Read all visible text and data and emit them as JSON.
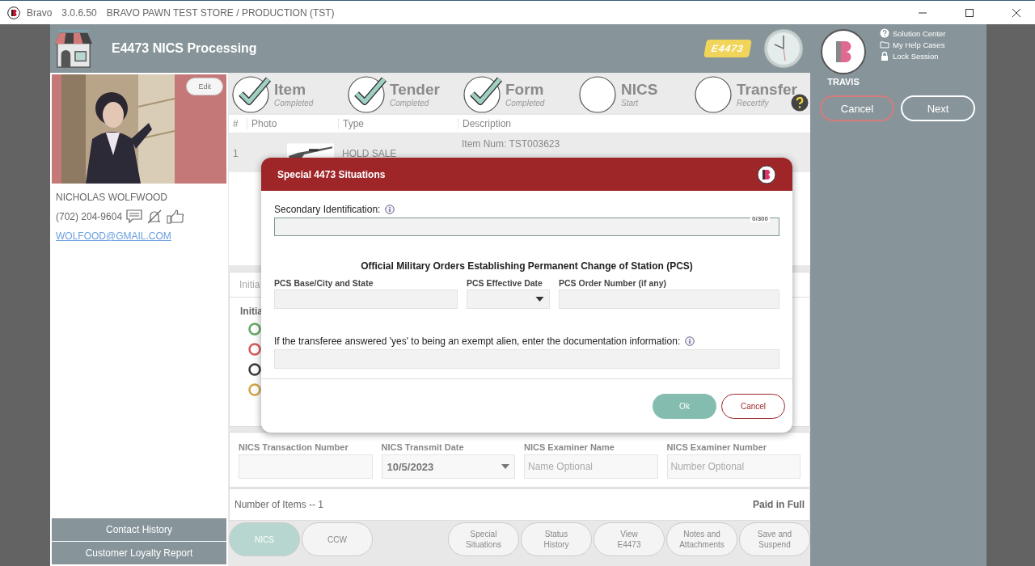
{
  "title_bar": {
    "app_name": "Bravo",
    "version": "3.0.6.50",
    "store": "BRAVO PAWN TEST STORE / PRODUCTION (TST)"
  },
  "header": {
    "title": "E4473 NICS Processing",
    "badge": "E4473"
  },
  "user": {
    "name": "TRAVIS",
    "links": [
      {
        "label": "Solution Center",
        "kind": "help"
      },
      {
        "label": "My Help Cases",
        "kind": "folder"
      },
      {
        "label": "Lock Session",
        "kind": "lock"
      }
    ],
    "buttons": [
      {
        "label": "Cancel",
        "kind": "danger"
      },
      {
        "label": "Next",
        "kind": "primary"
      }
    ]
  },
  "customer": {
    "edit": "Edit",
    "name": "NICHOLAS WOLFWOOD",
    "phone": "(702) 204-9604",
    "email": "WOLFOOD@GMAIL.COM",
    "buttons": [
      "Contact History",
      "Customer Loyalty Report"
    ]
  },
  "steps": [
    {
      "label": "Item",
      "status": "Completed",
      "completed": true
    },
    {
      "label": "Tender",
      "status": "Completed",
      "completed": true
    },
    {
      "label": "Form",
      "status": "Completed",
      "completed": true
    },
    {
      "label": "NICS",
      "status": "Start",
      "completed": false
    },
    {
      "label": "Transfer",
      "status": "Recertify",
      "completed": false
    }
  ],
  "table": {
    "columns": [
      "#",
      "Photo",
      "Type",
      "Description"
    ],
    "rows": [
      {
        "number": "1",
        "type": "HOLD SALE",
        "description": "Item Num: TST003623",
        "selected": true
      }
    ]
  },
  "initial_panel": {
    "tab": "Initia",
    "heading": "Initia",
    "options": [
      {
        "color": "#62a862"
      },
      {
        "color": "#d75a5a"
      },
      {
        "color": "#3a3a3a"
      },
      {
        "color": "#d1a646"
      }
    ]
  },
  "nics_fields": [
    {
      "label": "NICS Transaction Number",
      "kind": "text"
    },
    {
      "label": "NICS Transmit Date",
      "kind": "dropdown",
      "value": "10/5/2023"
    },
    {
      "label": "NICS Examiner Name",
      "kind": "text",
      "placeholder": "Name Optional"
    },
    {
      "label": "NICS Examiner Number",
      "kind": "text",
      "placeholder": "Number Optional"
    }
  ],
  "summary": {
    "count": "Number of Items -- 1",
    "status": "Paid in Full"
  },
  "mode_buttons": [
    {
      "label": "NICS",
      "selected": true
    },
    {
      "label": "CCW",
      "selected": false
    }
  ],
  "action_buttons": [
    "Special\nSituations",
    "Status\nHistory",
    "View\nE4473",
    "Notes and\nAttachments",
    "Save and\nSuspend"
  ],
  "modal": {
    "title": "Special 4473 Situations",
    "secondary_id": {
      "label": "Secondary Identification:",
      "counter": "0/300"
    },
    "section_title": "Official Military Orders Establishing Permanent Change of Station (PCS)",
    "pcs_fields": [
      {
        "label": "PCS Base/City and State",
        "kind": "text"
      },
      {
        "label": "PCS Effective Date",
        "kind": "dropdown"
      },
      {
        "label": "PCS Order Number (if any)",
        "kind": "text"
      }
    ],
    "alien": {
      "label": "If the transferee answered 'yes' to being an exempt alien, enter the documentation information:"
    },
    "buttons": [
      {
        "label": "Ok",
        "kind": "primary"
      },
      {
        "label": "Cancel",
        "kind": "secondary"
      }
    ]
  }
}
